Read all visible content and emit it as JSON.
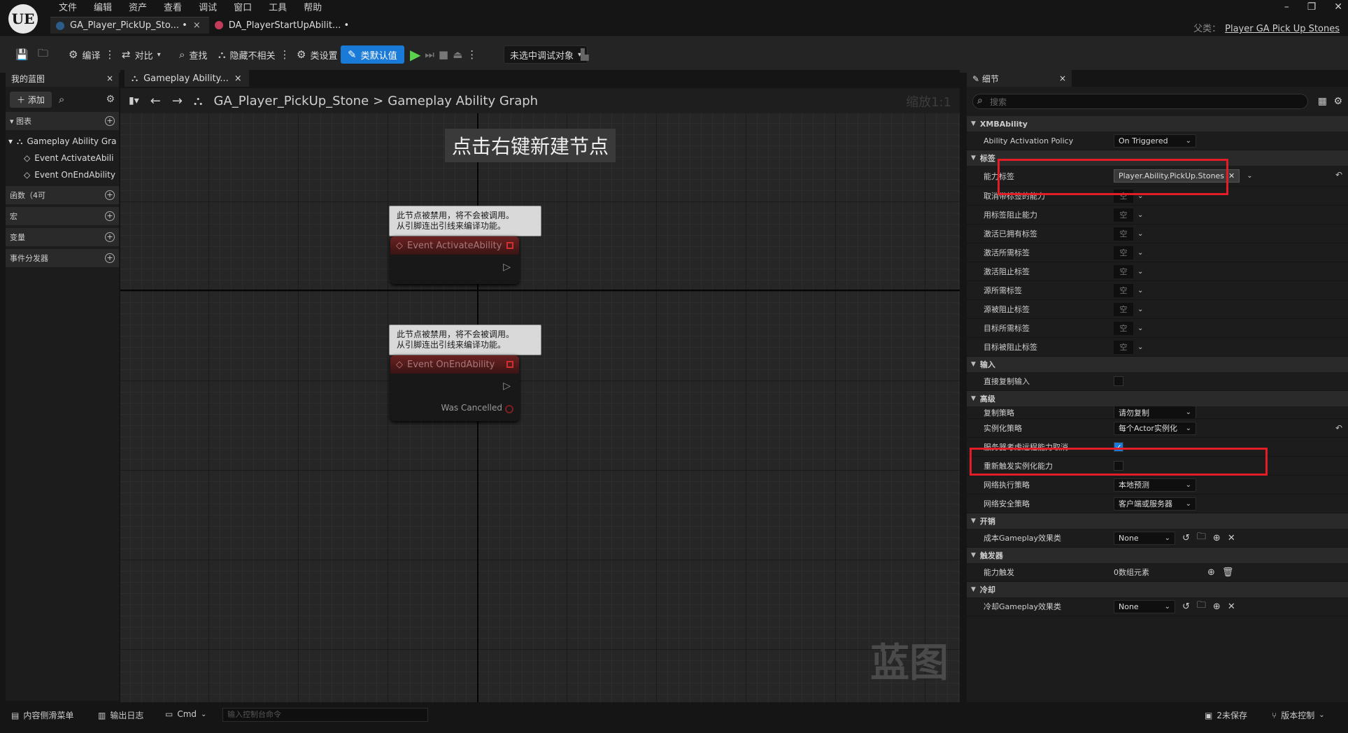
{
  "app": {
    "logo": "UE"
  },
  "menu": [
    "文件",
    "编辑",
    "资产",
    "查看",
    "调试",
    "窗口",
    "工具",
    "帮助"
  ],
  "tabs": [
    {
      "label": "GA_Player_PickUp_Sto... •",
      "active": true
    },
    {
      "label": "DA_PlayerStartUpAbilit... •",
      "active": false
    }
  ],
  "parent": {
    "prefix": "父类：",
    "name": "Player GA Pick Up Stones"
  },
  "toolbar": {
    "compile": "编译",
    "diff": "对比",
    "find": "查找",
    "hide_unrelated": "隐藏不相关",
    "class_settings": "类设置",
    "class_defaults": "类默认值",
    "debug_target": "未选中调试对象"
  },
  "left_panel": {
    "tab": "我的蓝图",
    "add": "添加",
    "graphs": "图表",
    "graph_item": "Gameplay Ability Gra",
    "events": [
      "Event ActivateAbili",
      "Event OnEndAbility"
    ],
    "functions": "函数（4可",
    "macros": "宏",
    "variables": "变量",
    "dispatchers": "事件分发器"
  },
  "graph": {
    "tab": "Gameplay Ability...",
    "breadcrumb_root": "GA_Player_PickUp_Stone",
    "breadcrumb_sep": ">",
    "breadcrumb_leaf": "Gameplay Ability Graph",
    "zoom": "缩放1:1",
    "hint": "点击右键新建节点",
    "watermark": "蓝图",
    "comment_line1": "此节点被禁用，将不会被调用。",
    "comment_line2": "从引脚连出引线来编译功能。",
    "node1": "Event ActivateAbility",
    "node2": "Event OnEndAbility",
    "was_cancelled": "Was Cancelled"
  },
  "details": {
    "tab": "细节",
    "search_placeholder": "搜索",
    "cat_xmb": "XMBAbility",
    "activation_policy_label": "Ability Activation Policy",
    "activation_policy_value": "On Triggered",
    "cat_tags": "标签",
    "ability_tags_label": "能力标签",
    "ability_tag_value": "Player.Ability.PickUp.Stones",
    "tag_rows": [
      "取消带标签的能力",
      "用标签阻止能力",
      "激活已拥有标签",
      "激活所需标签",
      "激活阻止标签",
      "源所需标签",
      "源被阻止标签",
      "目标所需标签",
      "目标被阻止标签"
    ],
    "empty_value": "空",
    "cat_input": "输入",
    "direct_replicate_input": "直接复制输入",
    "cat_advanced": "高级",
    "replication_policy_label": "复制策略",
    "replication_policy_value": "请勿复制",
    "instancing_policy_label": "实例化策略",
    "instancing_policy_value": "每个Actor实例化",
    "server_respects_cancel": "服务器考虑远程能力取消",
    "retrigger_instanced": "重新触发实例化能力",
    "net_exec_policy_label": "网络执行策略",
    "net_exec_policy_value": "本地预测",
    "net_security_policy_label": "网络安全策略",
    "net_security_policy_value": "客户端或服务器",
    "cat_costs": "开销",
    "cost_effect_label": "成本Gameplay效果类",
    "cost_effect_value": "None",
    "cat_triggers": "触发器",
    "ability_triggers_label": "能力触发",
    "ability_triggers_value": "0数组元素",
    "cat_cooldowns": "冷却",
    "cooldown_effect_label": "冷却Gameplay效果类",
    "cooldown_effect_value": "None"
  },
  "bottom": {
    "content_drawer": "内容侧滑菜单",
    "output_log": "输出日志",
    "cmd": "Cmd",
    "console_placeholder": "输入控制台命令",
    "unsaved": "2未保存",
    "source_control": "版本控制"
  },
  "colors": {
    "accent": "#1a7ad8",
    "highlight": "#e21d28",
    "play": "#5bd24c"
  }
}
